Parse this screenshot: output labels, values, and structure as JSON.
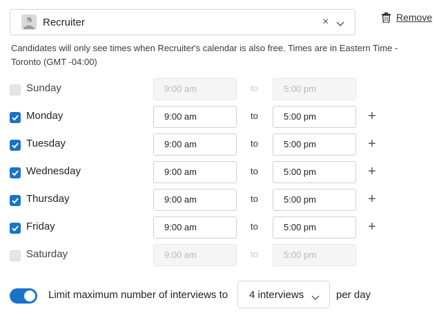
{
  "interviewer": {
    "name": "Recruiter",
    "clear_symbol": "×",
    "remove_label": "Remove"
  },
  "note": "Candidates will only see times when Recruiter's calendar is also free. Times are in Eastern Time - Toronto (GMT -04:00)",
  "days": [
    {
      "label": "Sunday",
      "checked": false,
      "start": "9:00 am",
      "to": "to",
      "end": "5:00 pm"
    },
    {
      "label": "Monday",
      "checked": true,
      "start": "9:00 am",
      "to": "to",
      "end": "5:00 pm"
    },
    {
      "label": "Tuesday",
      "checked": true,
      "start": "9:00 am",
      "to": "to",
      "end": "5:00 pm"
    },
    {
      "label": "Wednesday",
      "checked": true,
      "start": "9:00 am",
      "to": "to",
      "end": "5:00 pm"
    },
    {
      "label": "Thursday",
      "checked": true,
      "start": "9:00 am",
      "to": "to",
      "end": "5:00 pm"
    },
    {
      "label": "Friday",
      "checked": true,
      "start": "9:00 am",
      "to": "to",
      "end": "5:00 pm"
    },
    {
      "label": "Saturday",
      "checked": false,
      "start": "9:00 am",
      "to": "to",
      "end": "5:00 pm"
    }
  ],
  "add_symbol": "+",
  "limit": {
    "enabled": true,
    "label": "Limit maximum number of interviews to",
    "value": "4 interviews",
    "suffix": "per day"
  },
  "colors": {
    "accent": "#1a73c9"
  },
  "icons": {
    "avatar": "person-placeholder-icon",
    "trash": "trash-icon",
    "chevron": "chevron-down-icon"
  }
}
